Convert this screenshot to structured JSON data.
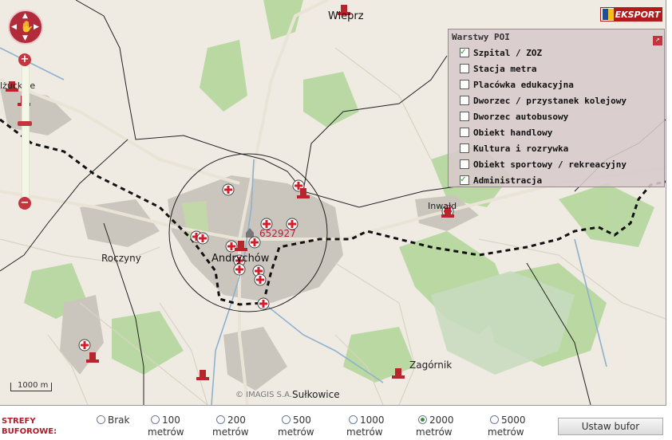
{
  "map": {
    "towns": {
      "wieprz": "Wieprz",
      "suchwice": "Sulkowice",
      "roczyny": "Roczyny",
      "andrychow": "Andrychów",
      "inwald": "Inwałd",
      "zagornik": "Zagórnik",
      "sulkowice": "Sułkowice",
      "left_edge": "lżuckice"
    },
    "buffer_id": "652927",
    "scale_label": "1000 m",
    "copyright": "© IMAGIS S.A.",
    "colors": {
      "water": "#8fb1cf",
      "forest": "#a9cf8f",
      "urban": "#cbc6bd",
      "poi": "#c4363f"
    }
  },
  "nav": {
    "arrow_up": "▲",
    "arrow_down": "▼",
    "arrow_left": "◀",
    "arrow_right": "▶",
    "hand": "✋"
  },
  "zoom": {
    "plus": "+",
    "minus": "−"
  },
  "export": {
    "label": "EKSPORT"
  },
  "poi_panel": {
    "title": "Warstwy POI",
    "items": [
      {
        "label": "Szpital / ZOZ",
        "checked": true
      },
      {
        "label": "Stacja metra",
        "checked": false
      },
      {
        "label": "Placówka edukacyjna",
        "checked": false
      },
      {
        "label": "Dworzec / przystanek kolejowy",
        "checked": false
      },
      {
        "label": "Dworzec autobusowy",
        "checked": false
      },
      {
        "label": "Obiekt handlowy",
        "checked": false
      },
      {
        "label": "Kultura i rozrywka",
        "checked": false
      },
      {
        "label": "Obiekt sportowy / rekreacyjny",
        "checked": false
      },
      {
        "label": "Administracja",
        "checked": true
      }
    ]
  },
  "buffer_bar": {
    "header_line1": "STREFY",
    "header_line2": "BUFOROWE:",
    "options": [
      {
        "value": "Brak",
        "unit": "",
        "selected": false
      },
      {
        "value": "100",
        "unit": "metrów",
        "selected": false
      },
      {
        "value": "200",
        "unit": "metrów",
        "selected": false
      },
      {
        "value": "500",
        "unit": "metrów",
        "selected": false
      },
      {
        "value": "1000",
        "unit": "metrów",
        "selected": false
      },
      {
        "value": "2000",
        "unit": "metrów",
        "selected": true
      },
      {
        "value": "5000",
        "unit": "metrów",
        "selected": false
      }
    ],
    "button": "Ustaw bufor"
  }
}
